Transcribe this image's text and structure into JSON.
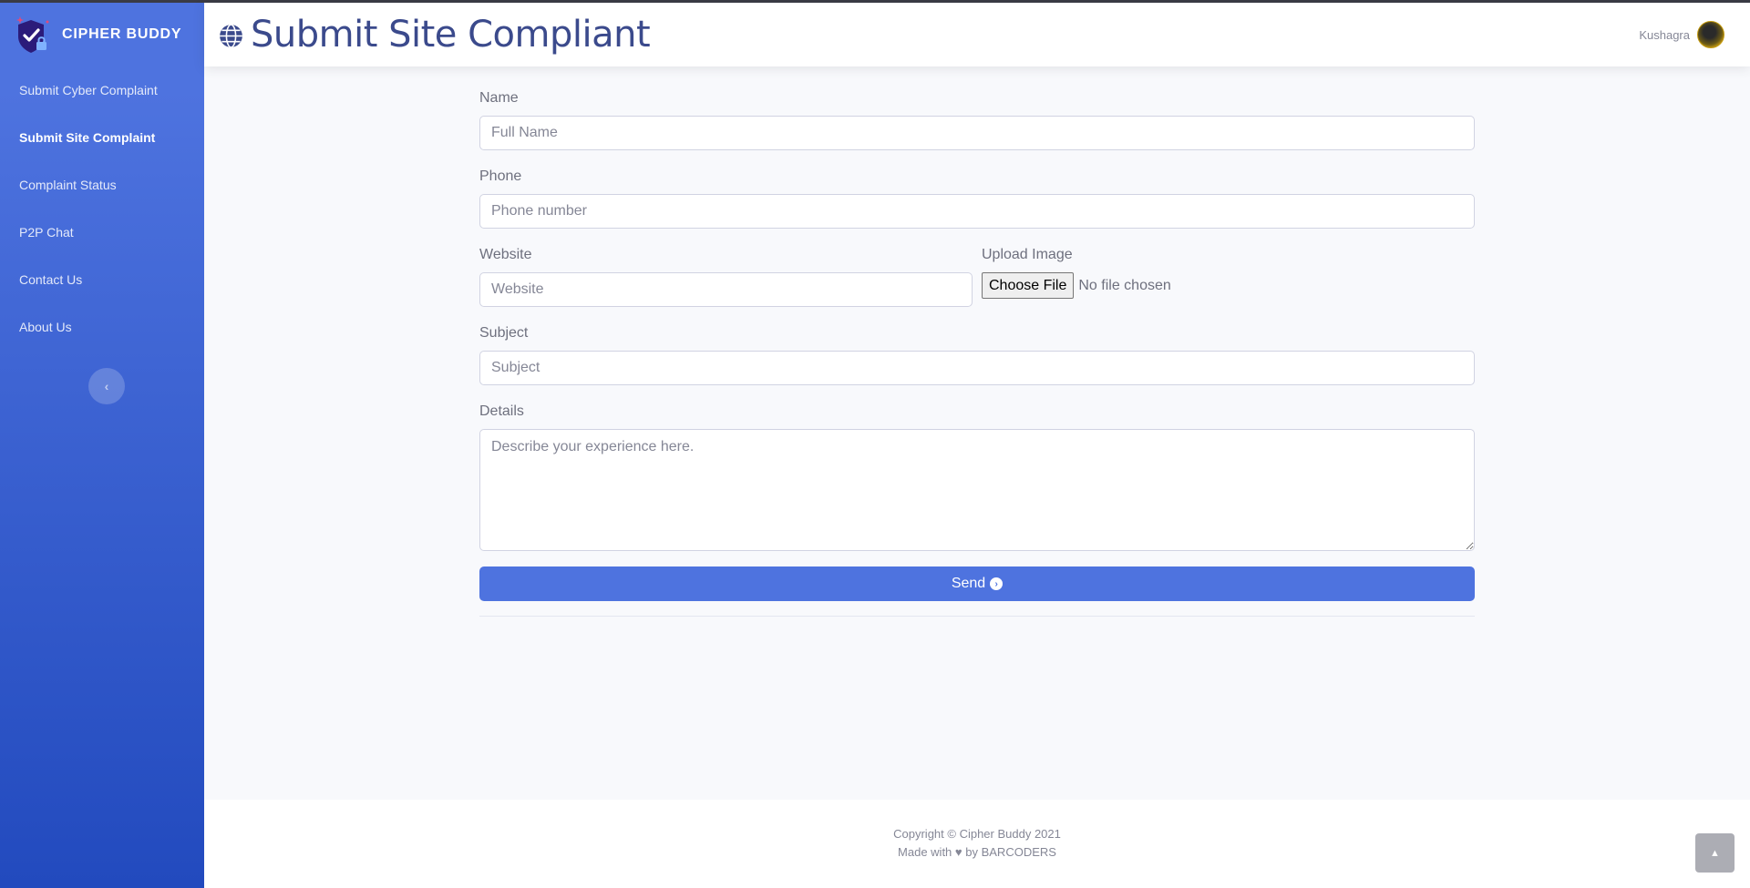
{
  "brand": {
    "name": "CIPHER BUDDY",
    "logo_icon": "shield-check-lock-icon"
  },
  "sidebar": {
    "items": [
      {
        "label": "Submit Cyber Complaint",
        "active": false
      },
      {
        "label": "Submit Site Complaint",
        "active": true
      },
      {
        "label": "Complaint Status",
        "active": false
      },
      {
        "label": "P2P Chat",
        "active": false
      },
      {
        "label": "Contact Us",
        "active": false
      },
      {
        "label": "About Us",
        "active": false
      }
    ],
    "toggle_icon": "‹"
  },
  "header": {
    "title": "Submit Site Compliant",
    "title_icon": "globe-icon"
  },
  "user": {
    "name": "Kushagra"
  },
  "form": {
    "name_label": "Name",
    "name_placeholder": "Full Name",
    "name_value": "",
    "phone_label": "Phone",
    "phone_placeholder": "Phone number",
    "phone_value": "",
    "website_label": "Website",
    "website_placeholder": "Website",
    "website_value": "",
    "upload_label": "Upload Image",
    "upload_button": "Choose File",
    "upload_status": "No file chosen",
    "subject_label": "Subject",
    "subject_placeholder": "Subject",
    "subject_value": "",
    "details_label": "Details",
    "details_placeholder": "Describe your experience here.",
    "send_label": "Send"
  },
  "footer": {
    "copyright": "Copyright © Cipher Buddy 2021",
    "made_prefix": "Made with",
    "made_suffix": "by BARCODERS"
  },
  "colors": {
    "primary": "#4e73df",
    "sidebar_bottom": "#224abe",
    "title": "#3b4a8c"
  }
}
